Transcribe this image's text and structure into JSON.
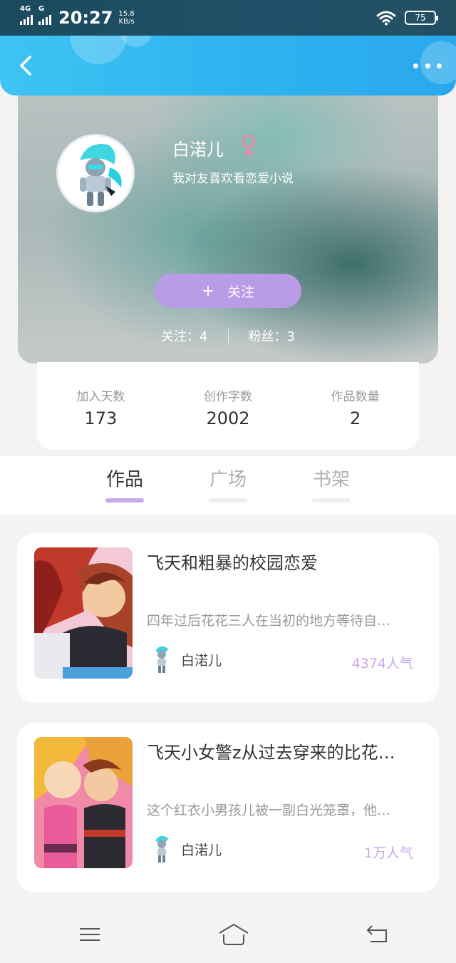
{
  "status_bar": {
    "network1": "4G",
    "network2": "G",
    "time": "20:27",
    "speed_value": "15.8",
    "speed_unit": "KB/s",
    "battery": "75"
  },
  "header": {
    "back_icon": "chevron-left-icon",
    "more_icon": "more-dots-icon"
  },
  "profile": {
    "name": "白渃儿",
    "gender_icon": "female-icon",
    "bio": "我对友喜欢看恋爱小说",
    "follow_button_label": "关注",
    "following_label": "关注：4",
    "fans_label": "粉丝：3"
  },
  "stats": [
    {
      "label": "加入天数",
      "value": "173"
    },
    {
      "label": "创作字数",
      "value": "2002"
    },
    {
      "label": "作品数量",
      "value": "2"
    }
  ],
  "tabs": [
    {
      "label": "作品",
      "active": true
    },
    {
      "label": "广场",
      "active": false
    },
    {
      "label": "书架",
      "active": false
    }
  ],
  "works": [
    {
      "title": "飞天和粗暴的校园恋爱",
      "description": "四年过后花花三人在当初的地方等待自…",
      "author": "白渃儿",
      "popularity": "4374人气"
    },
    {
      "title": "飞天小女警z从过去穿来的比花…",
      "description": "这个红衣小男孩儿被一副白光笼罩，他…",
      "author": "白渃儿",
      "popularity": "1万人气"
    }
  ],
  "nav": {
    "menu_icon": "menu-icon",
    "home_icon": "home-icon",
    "back_icon": "return-icon"
  },
  "colors": {
    "header_accent": "#2fb4f0",
    "follow_button": "#b99be6",
    "tab_indicator": "#c9a8ec",
    "popularity_text": "#c9a8ec",
    "gender_icon": "#e48aa6"
  }
}
